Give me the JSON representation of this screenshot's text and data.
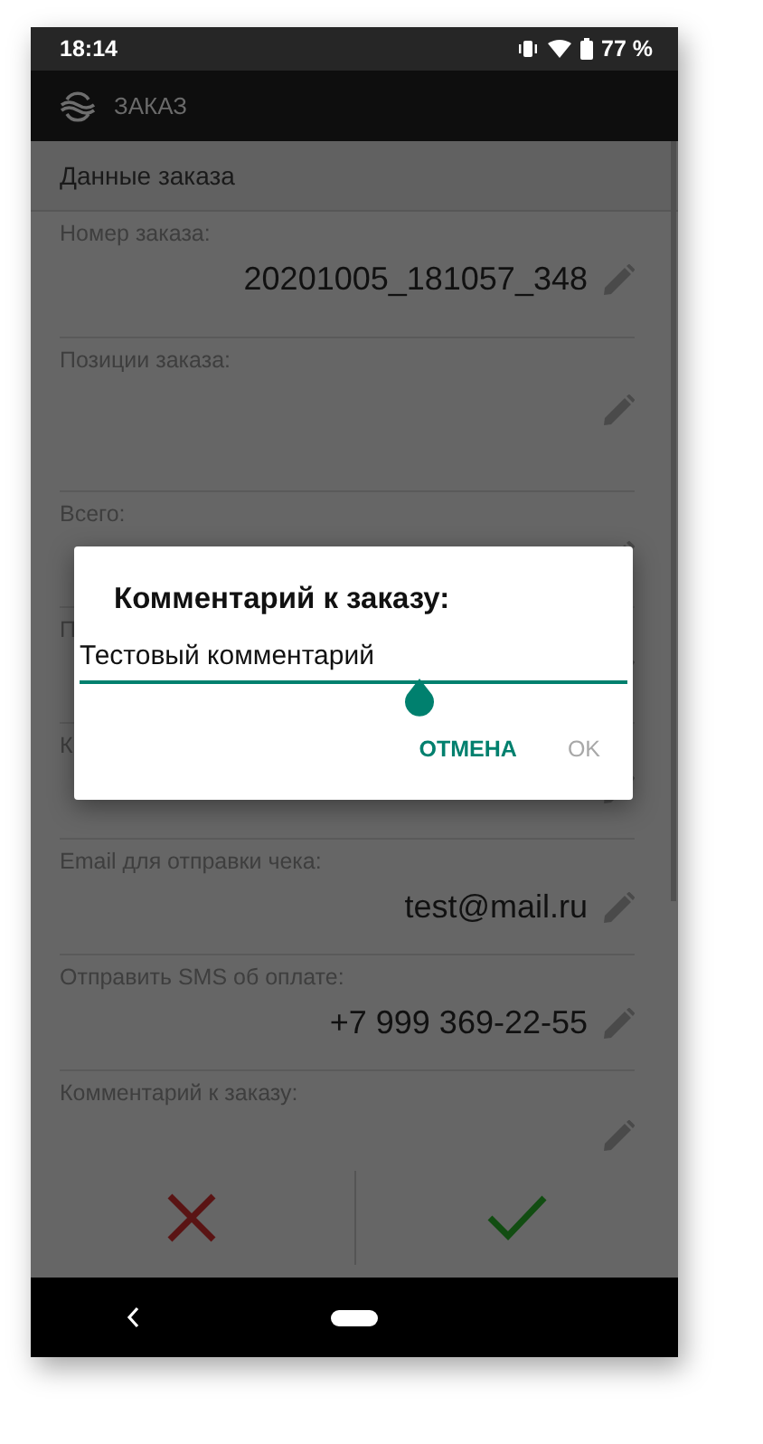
{
  "status_bar": {
    "time": "18:14",
    "battery": "77 %"
  },
  "app_bar": {
    "title": "ЗАКАЗ"
  },
  "section": {
    "title": "Данные заказа"
  },
  "fields": [
    {
      "kind": "text",
      "label": "Номер заказа:",
      "value": "20201005_181057_348"
    },
    {
      "kind": "list",
      "label": "Позиции заказа:"
    },
    {
      "kind": "text",
      "label": "Всего:"
    },
    {
      "kind": "text",
      "label": "П"
    },
    {
      "kind": "text",
      "label": "К"
    },
    {
      "kind": "text",
      "label": "Email для отправки чека:",
      "value": "test@mail.ru"
    },
    {
      "kind": "text",
      "label": "Отправить SMS об оплате:",
      "value": "+7 999 369-22-55"
    },
    {
      "kind": "text",
      "label": "Комментарий к заказу:"
    }
  ],
  "dialog": {
    "title": "Комментарий к заказу:",
    "value": "Тестовый комментарий",
    "buttons": [
      {
        "label": "ОТМЕНА",
        "disabled": false
      },
      {
        "label": "OK",
        "disabled": true
      }
    ]
  }
}
